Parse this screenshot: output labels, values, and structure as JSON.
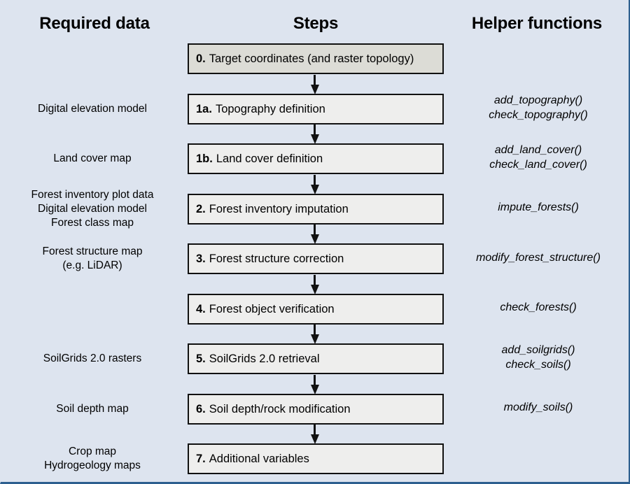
{
  "headers": {
    "required": "Required data",
    "steps": "Steps",
    "helpers": "Helper functions"
  },
  "rows": [
    {
      "required": "",
      "step_num": "0.",
      "step_label": "Target coordinates (and raster topology)",
      "helpers": ""
    },
    {
      "required": "Digital elevation model",
      "step_num": "1a.",
      "step_label": "Topography definition",
      "helpers": "add_topography()\ncheck_topography()"
    },
    {
      "required": "Land cover map",
      "step_num": "1b.",
      "step_label": "Land cover definition",
      "helpers": "add_land_cover()\ncheck_land_cover()"
    },
    {
      "required": "Forest inventory plot data\nDigital elevation model\nForest class map",
      "step_num": "2.",
      "step_label": "Forest inventory imputation",
      "helpers": "impute_forests()"
    },
    {
      "required": "Forest structure map\n(e.g. LiDAR)",
      "step_num": "3.",
      "step_label": "Forest structure correction",
      "helpers": "modify_forest_structure()"
    },
    {
      "required": "",
      "step_num": "4.",
      "step_label": "Forest object verification",
      "helpers": "check_forests()"
    },
    {
      "required": "SoilGrids 2.0 rasters",
      "step_num": "5.",
      "step_label": "SoilGrids 2.0 retrieval",
      "helpers": "add_soilgrids()\ncheck_soils()"
    },
    {
      "required": "Soil depth map",
      "step_num": "6.",
      "step_label": "Soil depth/rock modification",
      "helpers": "modify_soils()"
    },
    {
      "required": "Crop map\nHydrogeology maps",
      "step_num": "7.",
      "step_label": "Additional variables",
      "helpers": ""
    }
  ],
  "colors": {
    "background": "#dde4ef",
    "border": "#2d5f8f",
    "box_fill": "#eeeeed",
    "box_fill_first": "#dcdcd6",
    "box_stroke": "#111111"
  }
}
